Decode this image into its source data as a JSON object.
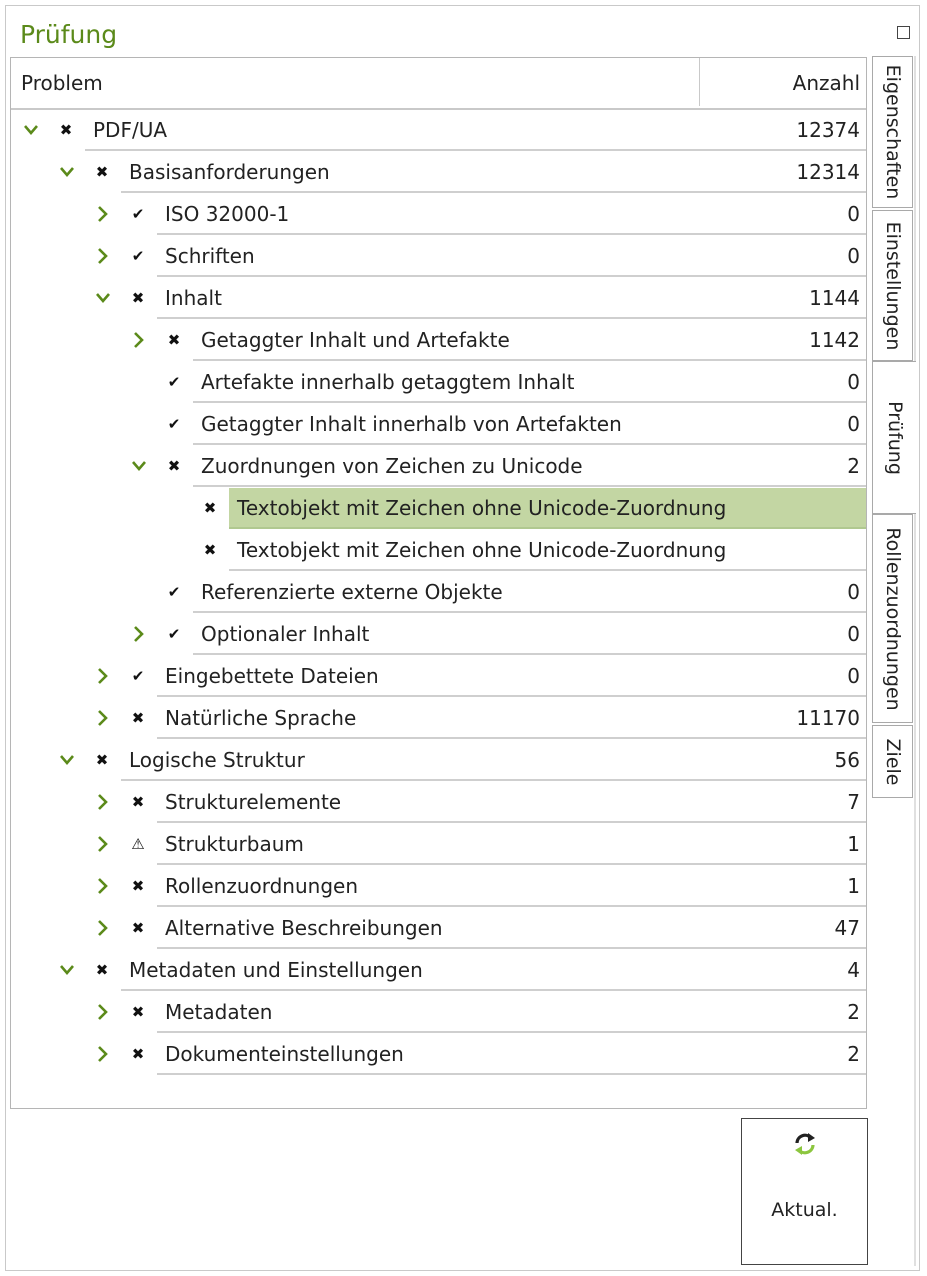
{
  "panel": {
    "title": "Prüfung"
  },
  "table": {
    "headers": {
      "problem": "Problem",
      "count": "Anzahl"
    },
    "rows": [
      {
        "level": 0,
        "expander": "expanded",
        "status": "error",
        "label": "PDF/UA",
        "count": "12374"
      },
      {
        "level": 1,
        "expander": "expanded",
        "status": "error",
        "label": "Basisanforderungen",
        "count": "12314"
      },
      {
        "level": 2,
        "expander": "collapsed",
        "status": "ok",
        "label": "ISO 32000-1",
        "count": "0"
      },
      {
        "level": 2,
        "expander": "collapsed",
        "status": "ok",
        "label": "Schriften",
        "count": "0"
      },
      {
        "level": 2,
        "expander": "expanded",
        "status": "error",
        "label": "Inhalt",
        "count": "1144"
      },
      {
        "level": 3,
        "expander": "collapsed",
        "status": "error",
        "label": "Getaggter Inhalt und Artefakte",
        "count": "1142"
      },
      {
        "level": 3,
        "expander": "none",
        "status": "ok",
        "label": "Artefakte innerhalb getaggtem Inhalt",
        "count": "0"
      },
      {
        "level": 3,
        "expander": "none",
        "status": "ok",
        "label": "Getaggter Inhalt innerhalb von Artefakten",
        "count": "0"
      },
      {
        "level": 3,
        "expander": "expanded",
        "status": "error",
        "label": "Zuordnungen von Zeichen zu Unicode",
        "count": "2"
      },
      {
        "level": 4,
        "expander": "none",
        "status": "error",
        "label": "Textobjekt mit Zeichen ohne Unicode-Zuordnung",
        "count": "",
        "selected": true
      },
      {
        "level": 4,
        "expander": "none",
        "status": "error",
        "label": "Textobjekt mit Zeichen ohne Unicode-Zuordnung",
        "count": ""
      },
      {
        "level": 3,
        "expander": "none",
        "status": "ok",
        "label": "Referenzierte externe Objekte",
        "count": "0"
      },
      {
        "level": 3,
        "expander": "collapsed",
        "status": "ok",
        "label": "Optionaler Inhalt",
        "count": "0"
      },
      {
        "level": 2,
        "expander": "collapsed",
        "status": "ok",
        "label": "Eingebettete Dateien",
        "count": "0"
      },
      {
        "level": 2,
        "expander": "collapsed",
        "status": "error",
        "label": "Natürliche Sprache",
        "count": "11170"
      },
      {
        "level": 1,
        "expander": "expanded",
        "status": "error",
        "label": "Logische Struktur",
        "count": "56"
      },
      {
        "level": 2,
        "expander": "collapsed",
        "status": "error",
        "label": "Strukturelemente",
        "count": "7"
      },
      {
        "level": 2,
        "expander": "collapsed",
        "status": "warning",
        "label": "Strukturbaum",
        "count": "1"
      },
      {
        "level": 2,
        "expander": "collapsed",
        "status": "error",
        "label": "Rollenzuordnungen",
        "count": "1"
      },
      {
        "level": 2,
        "expander": "collapsed",
        "status": "error",
        "label": "Alternative Beschreibungen",
        "count": "47"
      },
      {
        "level": 1,
        "expander": "expanded",
        "status": "error",
        "label": "Metadaten und Einstellungen",
        "count": "4"
      },
      {
        "level": 2,
        "expander": "collapsed",
        "status": "error",
        "label": "Metadaten",
        "count": "2"
      },
      {
        "level": 2,
        "expander": "collapsed",
        "status": "error",
        "label": "Dokumenteinstellungen",
        "count": "2"
      }
    ]
  },
  "tabs": [
    {
      "label": "Eigenschaften",
      "active": false
    },
    {
      "label": "Einstellungen",
      "active": false
    },
    {
      "label": "Prüfung",
      "active": true
    },
    {
      "label": "Rollenzuordnungen",
      "active": false
    },
    {
      "label": "Ziele",
      "active": false
    }
  ],
  "refresh": {
    "label": "Aktual.",
    "icon": "refresh-icon"
  },
  "colors": {
    "accent": "#5b8a1a",
    "selected_row": "#c3d6a3",
    "icon_green": "#8cc63f"
  },
  "status_glyphs": {
    "error": "✖",
    "ok": "✔",
    "warning": "⚠"
  }
}
